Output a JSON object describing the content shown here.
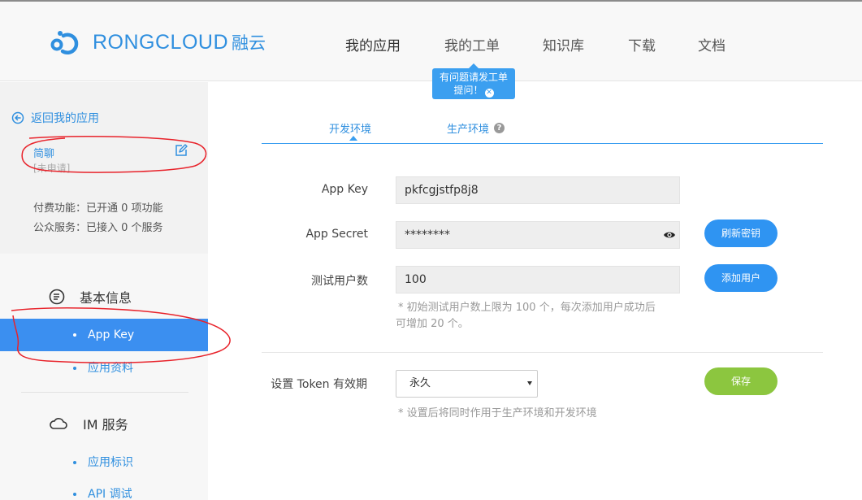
{
  "header": {
    "brand": "RONGCLOUD",
    "brand_cn": "融云",
    "nav": [
      "我的应用",
      "我的工单",
      "知识库",
      "下载",
      "文档"
    ],
    "tip_line1": "有问题请发工单",
    "tip_line2": "提问！"
  },
  "sidebar": {
    "back_label": "返回我的应用",
    "app_name": "简聊",
    "app_status": "[未申请]",
    "paid_features": "付费功能：已开通 0 项功能",
    "public_services": "公众服务：已接入 0 个服务",
    "section_basic": "基本信息",
    "item_app_key": "App Key",
    "item_app_info": "应用资料",
    "section_im": "IM 服务",
    "item_app_id": "应用标识",
    "item_api_debug": "API 调试"
  },
  "main": {
    "tab_dev": "开发环境",
    "tab_prod": "生产环境",
    "app_key_label": "App Key",
    "app_key_value": "pkfcgjstfp8j8",
    "app_secret_label": "App Secret",
    "app_secret_value": "********",
    "refresh_secret": "刷新密钥",
    "test_users_label": "测试用户数",
    "test_users_value": "100",
    "add_user": "添加用户",
    "test_users_hint_line1": "* 初始测试用户数上限为 100 个，每次添加用户成功后",
    "test_users_hint_line2": "可增加 20 个。",
    "token_label": "设置 Token 有效期",
    "token_value": "永久",
    "save": "保存",
    "token_hint": "* 设置后将同时作用于生产环境和开发环境"
  },
  "colors": {
    "accent": "#2f8fdf",
    "active_menu": "#3b8ff0",
    "save_button": "#8cc63f",
    "annotation": "#e8232b"
  }
}
